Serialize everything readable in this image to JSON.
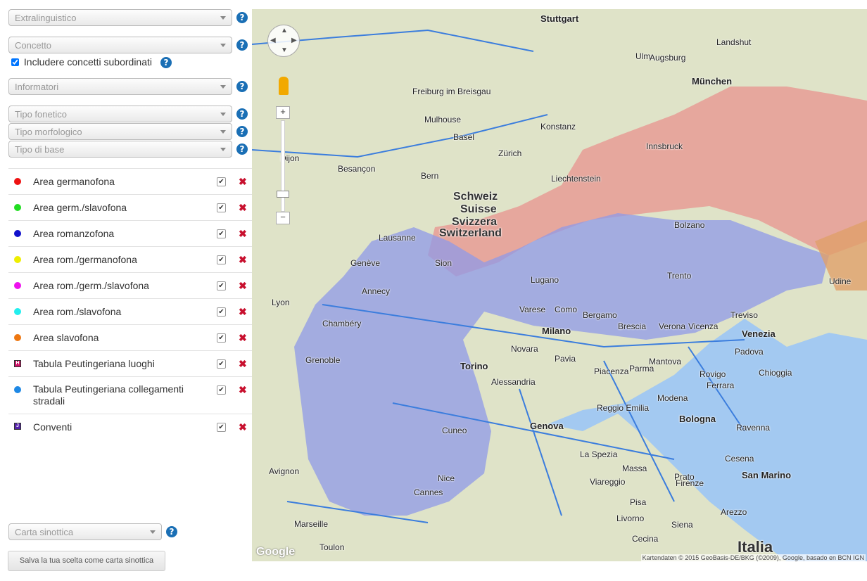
{
  "sidebar": {
    "selects": {
      "extralinguistico": "Extralinguistico",
      "concetto": "Concetto",
      "informatori": "Informatori",
      "tipo_fonetico": "Tipo fonetico",
      "tipo_morfologico": "Tipo morfologico",
      "tipo_di_base": "Tipo di base"
    },
    "subordinate_label": "Includere concetti subordinati",
    "help_glyph": "?",
    "legend": [
      {
        "label": "Area germanofona",
        "color": "#ee1111",
        "symbol": "dot"
      },
      {
        "label": "Area germ./slavofona",
        "color": "#22dd22",
        "symbol": "dot"
      },
      {
        "label": "Area romanzofona",
        "color": "#1111cc",
        "symbol": "dot"
      },
      {
        "label": "Area rom./germanofona",
        "color": "#eeee00",
        "symbol": "dot"
      },
      {
        "label": "Area rom./germ./slavofona",
        "color": "#ee11ee",
        "symbol": "dot"
      },
      {
        "label": "Area rom./slavofona",
        "color": "#22eeee",
        "symbol": "dot"
      },
      {
        "label": "Area slavofona",
        "color": "#ee7711",
        "symbol": "dot"
      },
      {
        "label": "Tabula Peutingeriana luoghi",
        "color": "#cc1166",
        "symbol": "square-h"
      },
      {
        "label": "Tabula Peutingeriana collegamenti stradali",
        "color": "#1e88e5",
        "symbol": "dot"
      },
      {
        "label": "Conventi",
        "color": "#5522aa",
        "symbol": "square-j"
      }
    ],
    "checkmark": "✔",
    "remove_glyph": "✖",
    "carta_sinottica": "Carta sinottica",
    "save_button": "Salva la tua scelta come carta sinottica"
  },
  "map": {
    "labels": {
      "schweiz": "Schweiz",
      "suisse": "Suisse",
      "svizzera": "Svizzera",
      "switzerland": "Switzerland",
      "stuttgart": "Stuttgart",
      "munchen": "München",
      "milano": "Milano",
      "venezia": "Venezia",
      "torino": "Torino",
      "genova": "Genova",
      "bologna": "Bologna",
      "lyon": "Lyon",
      "geneve": "Genève",
      "ulm": "Ulm",
      "augsburg": "Augsburg",
      "basel": "Basel",
      "zurich": "Zürich",
      "bern": "Bern",
      "landshut": "Landshut",
      "liechtenstein": "Liechtenstein",
      "trento": "Trento",
      "verona": "Verona",
      "padova": "Padova",
      "brescia": "Brescia",
      "bergamo": "Bergamo",
      "novara": "Novara",
      "alessandria": "Alessandria",
      "firenze": "Firenze",
      "livorno": "Livorno",
      "pisa": "Pisa",
      "marseille": "Marseille",
      "toulon": "Toulon",
      "grenoble": "Grenoble",
      "avignon": "Avignon",
      "san_marino": "San Marino",
      "ravenna": "Ravenna",
      "parma": "Parma",
      "la_spezia": "La Spezia",
      "cuneo": "Cuneo",
      "italia": "Italia",
      "besancon": "Besançon",
      "dijon": "Dijon",
      "freiburg": "Freiburg im Breisgau",
      "mulhouse": "Mulhouse",
      "konstanz": "Konstanz",
      "innsbruck": "Innsbruck",
      "bolzano": "Bolzano",
      "udine": "Udine",
      "treviso": "Treviso",
      "vicenza": "Vicenza",
      "mantova": "Mantova",
      "modena": "Modena",
      "reggio_emilia": "Reggio Emilia",
      "piacenza": "Piacenza",
      "pavia": "Pavia",
      "varese": "Varese",
      "como": "Como",
      "lugano": "Lugano",
      "sion": "Sion",
      "lausanne": "Lausanne",
      "annecy": "Annecy",
      "chambery": "Chambéry",
      "nice": "Nice",
      "cannes": "Cannes",
      "ferrara": "Ferrara",
      "cesena": "Cesena",
      "viareggio": "Viareggio",
      "massa": "Massa",
      "prato": "Prato",
      "siena": "Siena",
      "arezzo": "Arezzo",
      "cecina": "Cecina",
      "rovigo": "Rovigo",
      "chioggia": "Chioggia"
    },
    "google_logo": "Google",
    "attribution": "Kartendaten © 2015 GeoBasis-DE/BKG (©2009), Google, basado en BCN IGN"
  }
}
